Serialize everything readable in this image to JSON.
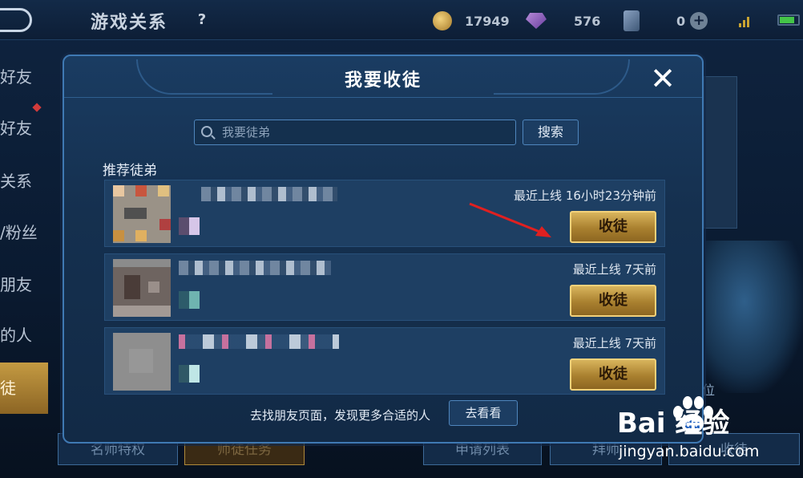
{
  "topbar": {
    "title": "游戏关系",
    "help_label": "?",
    "gold": "17949",
    "gems": "576",
    "cards": "0",
    "plus_label": "+"
  },
  "sidebar": {
    "items": [
      {
        "label": "好友"
      },
      {
        "label": "好友"
      },
      {
        "label": "关系"
      },
      {
        "label": "/粉丝"
      },
      {
        "label": "朋友"
      },
      {
        "label": "的人"
      },
      {
        "label": "徒"
      }
    ]
  },
  "bottom_tabs": [
    {
      "label": "名师特权"
    },
    {
      "label": "师徒任务"
    },
    {
      "label": "申请列表"
    },
    {
      "label": "拜师"
    },
    {
      "label": "收徒"
    }
  ],
  "background": {
    "position_text": "位"
  },
  "modal": {
    "title": "我要收徒",
    "close_label": "✕",
    "search": {
      "placeholder": "我要徒弟",
      "button_label": "搜索"
    },
    "section_label": "推荐徒弟",
    "rows": [
      {
        "last_online": "最近上线  16小时23分钟前",
        "button_label": "收徒"
      },
      {
        "last_online": "最近上线  7天前",
        "button_label": "收徒"
      },
      {
        "last_online": "最近上线  7天前",
        "button_label": "收徒"
      }
    ],
    "footer": {
      "text": "去找朋友页面，发现更多合适的人",
      "button_label": "去看看"
    }
  },
  "watermark": {
    "brand": "Bai  经验",
    "url": "jingyan.baidu.com"
  },
  "colors": {
    "modal_bg": "#15304f",
    "accent_gold": "#d8b45c",
    "border_blue": "#3f79b3",
    "arrow_red": "#e02020"
  },
  "icons": [
    "back-icon",
    "help-icon",
    "coin-icon",
    "gem-icon",
    "card-icon",
    "plus-icon",
    "signal-icon",
    "battery-icon",
    "close-icon",
    "search-icon",
    "arrow-pointer-icon",
    "baidu-paw-logo"
  ]
}
